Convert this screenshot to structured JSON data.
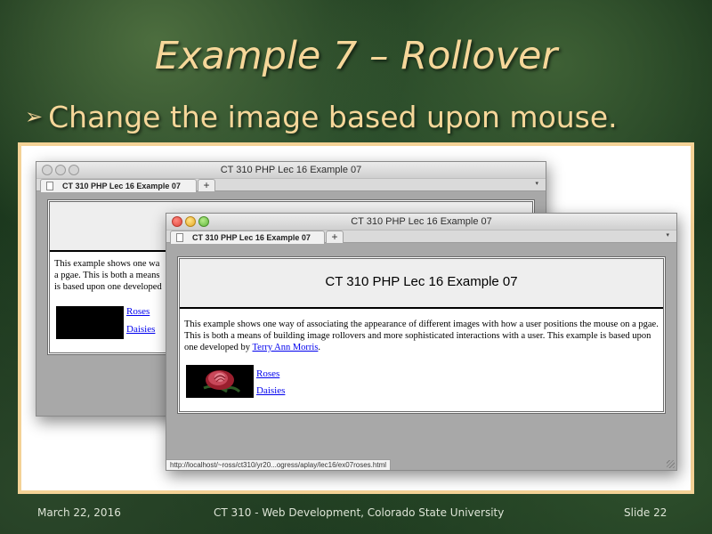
{
  "slide": {
    "title": "Example 7 – Rollover",
    "bullet": "Change the image based upon mouse.",
    "bullet_marker": "➢"
  },
  "back_window": {
    "title": "CT 310 PHP Lec 16 Example 07",
    "tab_label": "CT 310 PHP Lec 16 Example 07",
    "new_tab": "+",
    "tab_menu": "▾",
    "body_lines": [
      "This example shows one wa",
      "a pgae. This is both a means",
      "is based upon one developed"
    ],
    "links": [
      "Roses",
      "Daisies"
    ]
  },
  "front_window": {
    "title": "CT 310 PHP Lec 16 Example 07",
    "tab_label": "CT 310 PHP Lec 16 Example 07",
    "new_tab": "+",
    "tab_menu": "▾",
    "heading": "CT 310 PHP Lec 16 Example 07",
    "body_before": "This example shows one way of associating the appearance of different images with how a user positions the mouse on a pgae. This is both a means of building image rollovers and more sophisticated interactions with a user. This example is based upon one developed by ",
    "body_link": "Terry Ann Morris",
    "body_after": ".",
    "links": [
      "Roses",
      "Daisies"
    ],
    "status_url": "http://localhost/~ross/ct310/yr20...ogress/aplay/lec16/ex07roses.html"
  },
  "footer": {
    "date": "March 22, 2016",
    "course": "CT 310 - Web Development, Colorado State University",
    "slide": "Slide 22"
  }
}
